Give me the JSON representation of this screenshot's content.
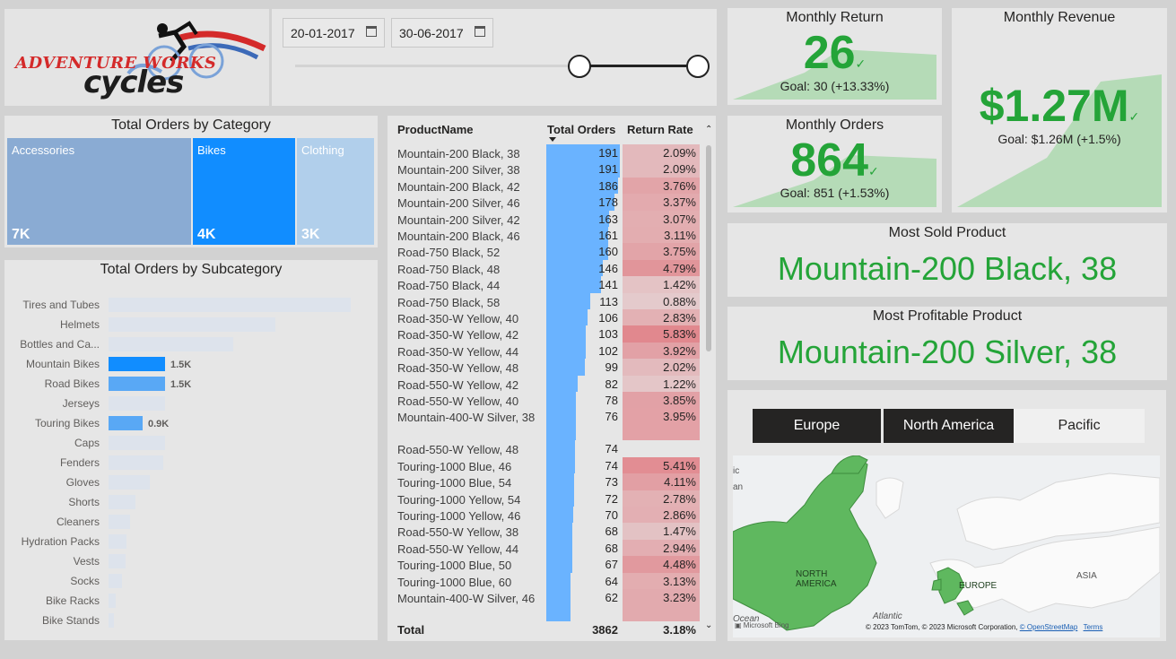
{
  "logo": {
    "line1": "ADVENTURE WORKS",
    "line2": "cycles"
  },
  "date_slicer": {
    "start_date": "20-01-2017",
    "end_date": "30-06-2017",
    "calendar_icon": "calendar-icon"
  },
  "monthly_return": {
    "title": "Monthly Return",
    "value": "26",
    "goal": "Goal: 30 (+13.33%)"
  },
  "monthly_revenue": {
    "title": "Monthly Revenue",
    "value": "$1.27M",
    "goal": "Goal: $1.26M (+1.5%)"
  },
  "monthly_orders": {
    "title": "Monthly Orders",
    "value": "864",
    "goal": "Goal: 851 (+1.53%)"
  },
  "most_sold": {
    "title": "Most Sold Product",
    "value": "Mountain-200 Black, 38"
  },
  "most_profitable": {
    "title": "Most Profitable Product",
    "value": "Mountain-200 Silver, 38"
  },
  "category_treemap": {
    "title": "Total Orders by Category",
    "items": [
      {
        "label": "Accessories",
        "value": "7K",
        "color": "#8aabd3"
      },
      {
        "label": "Bikes",
        "value": "4K",
        "color": "#118dff"
      },
      {
        "label": "Clothing",
        "value": "3K",
        "color": "#b1cfeb"
      }
    ]
  },
  "subcategory_chart": {
    "title": "Total Orders by Subcategory",
    "type": "bar",
    "items": [
      {
        "label": "Tires and Tubes",
        "value": 6400,
        "color": "#dde3ec",
        "data_label": ""
      },
      {
        "label": "Helmets",
        "value": 4400,
        "color": "#dde3ec",
        "data_label": ""
      },
      {
        "label": "Bottles and Ca...",
        "value": 3300,
        "color": "#dde3ec",
        "data_label": ""
      },
      {
        "label": "Mountain Bikes",
        "value": 1500,
        "color": "#118dff",
        "data_label": "1.5K"
      },
      {
        "label": "Road Bikes",
        "value": 1500,
        "color": "#59a8f5",
        "data_label": "1.5K"
      },
      {
        "label": "Jerseys",
        "value": 1500,
        "color": "#dde3ec",
        "data_label": ""
      },
      {
        "label": "Touring Bikes",
        "value": 900,
        "color": "#59a8f5",
        "data_label": "0.9K"
      },
      {
        "label": "Caps",
        "value": 1500,
        "color": "#dde3ec",
        "data_label": ""
      },
      {
        "label": "Fenders",
        "value": 1450,
        "color": "#dde3ec",
        "data_label": ""
      },
      {
        "label": "Gloves",
        "value": 1100,
        "color": "#dde3ec",
        "data_label": ""
      },
      {
        "label": "Shorts",
        "value": 700,
        "color": "#dde3ec",
        "data_label": ""
      },
      {
        "label": "Cleaners",
        "value": 560,
        "color": "#dde3ec",
        "data_label": ""
      },
      {
        "label": "Hydration Packs",
        "value": 470,
        "color": "#dde3ec",
        "data_label": ""
      },
      {
        "label": "Vests",
        "value": 440,
        "color": "#dde3ec",
        "data_label": ""
      },
      {
        "label": "Socks",
        "value": 360,
        "color": "#dde3ec",
        "data_label": ""
      },
      {
        "label": "Bike Racks",
        "value": 200,
        "color": "#dde3ec",
        "data_label": ""
      },
      {
        "label": "Bike Stands",
        "value": 150,
        "color": "#dde3ec",
        "data_label": ""
      }
    ],
    "xmax": 6400
  },
  "product_table": {
    "headers": {
      "name": "ProductName",
      "orders": "Total Orders",
      "rate": "Return Rate"
    },
    "rows": [
      {
        "name": "Mountain-200 Black, 38",
        "orders": 191,
        "rate": "2.09%",
        "rate_num": 2.09
      },
      {
        "name": "Mountain-200 Silver, 38",
        "orders": 191,
        "rate": "2.09%",
        "rate_num": 2.09
      },
      {
        "name": "Mountain-200 Black, 42",
        "orders": 186,
        "rate": "3.76%",
        "rate_num": 3.76
      },
      {
        "name": "Mountain-200 Silver, 46",
        "orders": 178,
        "rate": "3.37%",
        "rate_num": 3.37
      },
      {
        "name": "Mountain-200 Silver, 42",
        "orders": 163,
        "rate": "3.07%",
        "rate_num": 3.07
      },
      {
        "name": "Mountain-200 Black, 46",
        "orders": 161,
        "rate": "3.11%",
        "rate_num": 3.11
      },
      {
        "name": "Road-750 Black, 52",
        "orders": 160,
        "rate": "3.75%",
        "rate_num": 3.75
      },
      {
        "name": "Road-750 Black, 48",
        "orders": 146,
        "rate": "4.79%",
        "rate_num": 4.79
      },
      {
        "name": "Road-750 Black, 44",
        "orders": 141,
        "rate": "1.42%",
        "rate_num": 1.42
      },
      {
        "name": "Road-750 Black, 58",
        "orders": 113,
        "rate": "0.88%",
        "rate_num": 0.88
      },
      {
        "name": "Road-350-W Yellow, 40",
        "orders": 106,
        "rate": "2.83%",
        "rate_num": 2.83
      },
      {
        "name": "Road-350-W Yellow, 42",
        "orders": 103,
        "rate": "5.83%",
        "rate_num": 5.83
      },
      {
        "name": "Road-350-W Yellow, 44",
        "orders": 102,
        "rate": "3.92%",
        "rate_num": 3.92
      },
      {
        "name": "Road-350-W Yellow, 48",
        "orders": 99,
        "rate": "2.02%",
        "rate_num": 2.02
      },
      {
        "name": "Road-550-W Yellow, 42",
        "orders": 82,
        "rate": "1.22%",
        "rate_num": 1.22
      },
      {
        "name": "Road-550-W Yellow, 40",
        "orders": 78,
        "rate": "3.85%",
        "rate_num": 3.85
      },
      {
        "name": "Mountain-400-W Silver, 38",
        "orders": 76,
        "rate": "3.95%",
        "rate_num": 3.95
      },
      {
        "name": "Road-550-W Yellow, 48",
        "orders": 74,
        "rate": "",
        "rate_num": 0
      },
      {
        "name": "Touring-1000 Blue, 46",
        "orders": 74,
        "rate": "5.41%",
        "rate_num": 5.41
      },
      {
        "name": "Touring-1000 Blue, 54",
        "orders": 73,
        "rate": "4.11%",
        "rate_num": 4.11
      },
      {
        "name": "Touring-1000 Yellow, 54",
        "orders": 72,
        "rate": "2.78%",
        "rate_num": 2.78
      },
      {
        "name": "Touring-1000 Yellow, 46",
        "orders": 70,
        "rate": "2.86%",
        "rate_num": 2.86
      },
      {
        "name": "Road-550-W Yellow, 38",
        "orders": 68,
        "rate": "1.47%",
        "rate_num": 1.47
      },
      {
        "name": "Road-550-W Yellow, 44",
        "orders": 68,
        "rate": "2.94%",
        "rate_num": 2.94
      },
      {
        "name": "Touring-1000 Blue, 50",
        "orders": 67,
        "rate": "4.48%",
        "rate_num": 4.48
      },
      {
        "name": "Touring-1000 Blue, 60",
        "orders": 64,
        "rate": "3.13%",
        "rate_num": 3.13
      },
      {
        "name": "Mountain-400-W Silver, 46",
        "orders": 62,
        "rate": "3.23%",
        "rate_num": 3.23
      }
    ],
    "total": {
      "label": "Total",
      "orders": "3862",
      "rate": "3.18%"
    },
    "max_orders": 191
  },
  "region_slicer": {
    "buttons": [
      {
        "label": "Europe",
        "selected": true
      },
      {
        "label": "North America",
        "selected": true
      },
      {
        "label": "Pacific",
        "selected": false
      }
    ]
  },
  "map": {
    "labels": {
      "north_america": "NORTH\nAMERICA",
      "europe": "EUROPE",
      "asia": "ASIA",
      "atlantic": "Atlantic",
      "ocean": "Ocean",
      "edge_top": "ic",
      "edge_mid": "an"
    },
    "bing": "Microsoft Bing",
    "attribution": "© 2023 TomTom, © 2023 Microsoft Corporation,",
    "osm_link": "© OpenStreetMap",
    "terms_link": "Terms",
    "highlight_color": "#5fb85f"
  },
  "colors": {
    "accent_green": "#24a438",
    "bar_blue": "#6ab3ff",
    "rate_red": "#e07d84"
  }
}
